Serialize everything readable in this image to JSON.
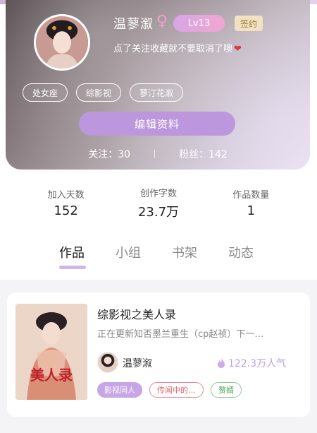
{
  "profile": {
    "username": "温蓼溆",
    "gender_symbol": "♀",
    "level": "Lv13",
    "sign_badge": "签约",
    "bio": "点了关注收藏就不要取消了噢",
    "bio_heart": "❤",
    "tags": [
      "处女座",
      "综影视",
      "蓼汀花溆"
    ],
    "edit_button": "编辑资料",
    "following_label": "关注：",
    "following_count": "30",
    "followers_label": "粉丝：",
    "followers_count": "142"
  },
  "stats": [
    {
      "label": "加入天数",
      "value": "152"
    },
    {
      "label": "创作字数",
      "value": "23.7万"
    },
    {
      "label": "作品数量",
      "value": "1"
    }
  ],
  "tabs": [
    {
      "label": "作品",
      "active": true
    },
    {
      "label": "小组",
      "active": false
    },
    {
      "label": "书架",
      "active": false
    },
    {
      "label": "动态",
      "active": false
    }
  ],
  "work": {
    "title": "综影视之美人录",
    "description": "正在更新知否墨兰重生（cp赵祯）下一…",
    "author": "温蓼溆",
    "popularity": "122.3万人气",
    "cover_title": "美人录",
    "chips": [
      {
        "label": "影视同人",
        "style": "purple"
      },
      {
        "label": "传闻中的…",
        "style": "red"
      },
      {
        "label": "赘婿",
        "style": "green"
      }
    ]
  },
  "colors": {
    "accent": "#bc97de",
    "level_badge": "#e0a6dc",
    "heart": "#e2353a"
  },
  "icons": [
    "female-gender-icon",
    "heart-icon",
    "flame-icon"
  ]
}
